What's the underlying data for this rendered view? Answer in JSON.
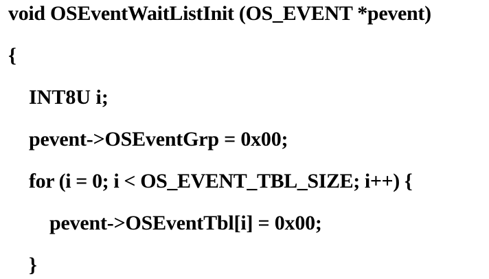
{
  "code": {
    "lines": [
      "void OSEventWaitListInit (OS_EVENT *pevent)",
      "{",
      "INT8U i;",
      "pevent->OSEventGrp = 0x00;",
      "for (i = 0; i < OS_EVENT_TBL_SIZE; i++) {",
      "pevent->OSEventTbl[i] = 0x00;",
      "}"
    ]
  }
}
